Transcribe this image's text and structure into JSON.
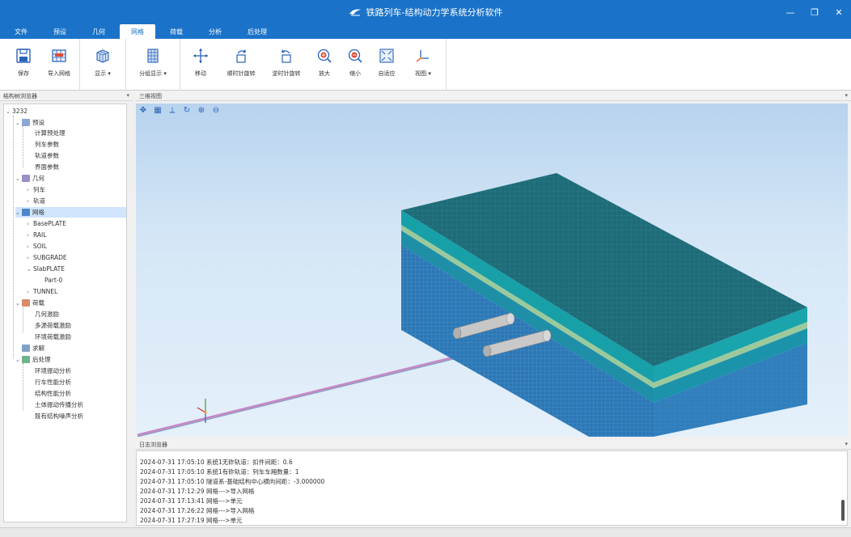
{
  "window": {
    "title": "铁路列车-结构动力学系统分析软件",
    "minimize": "—",
    "maximize": "❐",
    "close": "✕"
  },
  "menu": {
    "tabs": [
      "文件",
      "预设",
      "几何",
      "网格",
      "荷载",
      "分析",
      "后处理"
    ],
    "active": "网格"
  },
  "ribbon": {
    "save": "保存",
    "import_mesh": "导入网格",
    "display": "显示",
    "group_display": "分组显示",
    "move": "移动",
    "rotate_cw": "顺时针旋转",
    "rotate_ccw": "逆时针旋转",
    "zoom_in": "放大",
    "zoom_out": "缩小",
    "fit": "自适应",
    "view": "视图"
  },
  "panels": {
    "tree_title": "结构树浏览器",
    "view_title": "三维视图",
    "log_title": "日志浏览器",
    "pin": "▾ ×"
  },
  "tree": {
    "root": "3232",
    "preset": "预设",
    "preset_items": [
      "计算预处理",
      "列车参数",
      "轨道参数",
      "界面参数"
    ],
    "geometry": "几何",
    "geometry_items": [
      "列车",
      "轨道"
    ],
    "mesh": "网格",
    "mesh_items": [
      "BasePLATE",
      "RAIL",
      "SOIL",
      "SUBGRADE",
      "SlabPLATE",
      "TUNNEL"
    ],
    "slab_child": "Part-0",
    "load": "荷载",
    "load_items": [
      "几何激励",
      "多源荷载激励",
      "环境荷载激励"
    ],
    "solve": "求解",
    "post": "后处理",
    "post_items": [
      "环境振动分析",
      "行车性能分析",
      "结构性能分析",
      "土体振动传播分析",
      "既有结构噪声分析"
    ]
  },
  "log": {
    "lines": [
      "2024-07-31 17:05:10 系统1无砟轨道：扣件间距：0.6",
      "2024-07-31 17:05:10 系统1有砟轨道：列车车厢数量：1",
      "2024-07-31 17:05:10 隧道系-基础结构中心横向间距：-3.000000",
      "2024-07-31 17:12:29 网格--->导入网格",
      "2024-07-31 17:13:41 网格--->单元",
      "2024-07-31 17:26:22 网格--->导入网格",
      "2024-07-31 17:27:19 网格--->单元"
    ]
  },
  "colors": {
    "accent": "#1a73c9",
    "top_face": "#1f6b78",
    "layer_green": "#9cc99c",
    "layer_teal": "#17a0a8",
    "side_blue": "#2c78b6"
  }
}
